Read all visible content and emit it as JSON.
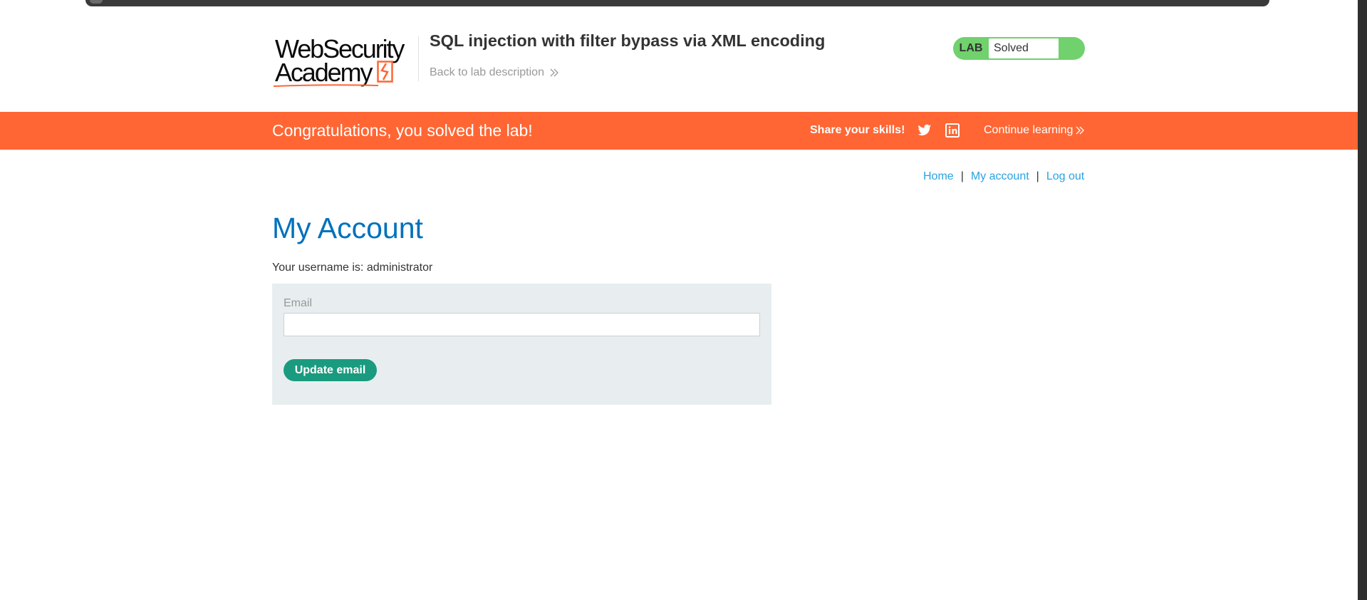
{
  "colors": {
    "accent_orange": "#ff6633",
    "title_blue": "#0071bc",
    "link_blue": "#29a3e1",
    "status_green": "#70d16d",
    "button_green": "#1a9b7f",
    "panel_grey": "#e8eef0"
  },
  "logo": {
    "line1": "WebSecurity",
    "line2": "Academy",
    "icon": "lightning-bolt-icon"
  },
  "header": {
    "lab_title": "SQL injection with filter bypass via XML encoding",
    "back_link": "Back to lab description",
    "back_icon": "double-chevron-right-icon"
  },
  "lab_status": {
    "label": "LAB",
    "status": "Solved"
  },
  "banner": {
    "message": "Congratulations, you solved the lab!",
    "share_label": "Share your skills!",
    "twitter_icon": "twitter-icon",
    "linkedin_icon": "linkedin-icon",
    "continue_label": "Continue learning",
    "continue_icon": "double-chevron-right-icon"
  },
  "nav": {
    "items": [
      "Home",
      "My account",
      "Log out"
    ],
    "separator": "|"
  },
  "main": {
    "title": "My Account",
    "username_line": "Your username is: administrator",
    "email_label": "Email",
    "email_value": "",
    "update_button": "Update email"
  }
}
